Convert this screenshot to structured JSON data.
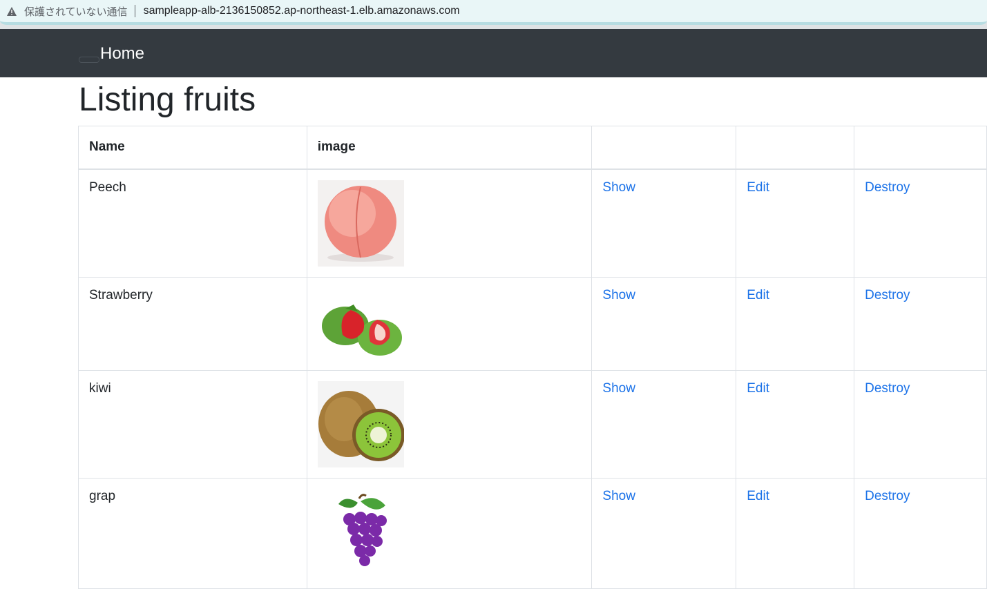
{
  "browser": {
    "security_label": "保護されていない通信",
    "url": "sampleapp-alb-2136150852.ap-northeast-1.elb.amazonaws.com",
    "warning_icon": "warning-triangle-icon"
  },
  "navbar": {
    "home_label": "Home"
  },
  "page": {
    "title": "Listing fruits"
  },
  "table": {
    "headers": [
      "Name",
      "image",
      "",
      "",
      ""
    ],
    "rows": [
      {
        "name": "Peech",
        "image": "peach-image",
        "show": "Show",
        "edit": "Edit",
        "destroy": "Destroy"
      },
      {
        "name": "Strawberry",
        "image": "strawberry-image",
        "show": "Show",
        "edit": "Edit",
        "destroy": "Destroy"
      },
      {
        "name": "kiwi",
        "image": "kiwi-image",
        "show": "Show",
        "edit": "Edit",
        "destroy": "Destroy"
      },
      {
        "name": "grap",
        "image": "grape-image",
        "show": "Show",
        "edit": "Edit",
        "destroy": "Destroy"
      }
    ]
  },
  "colors": {
    "navbar_bg": "#343a40",
    "link": "#1b72e8",
    "text": "#212529"
  }
}
